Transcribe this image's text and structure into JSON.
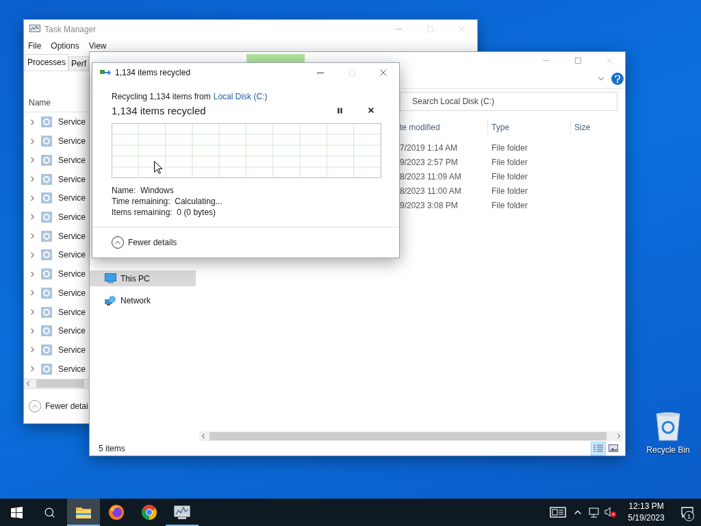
{
  "task_manager": {
    "title": "Task Manager",
    "menu": [
      "File",
      "Options",
      "View"
    ],
    "tabs": [
      {
        "label": "Processes",
        "selected": true
      },
      {
        "label": "Perf",
        "selected": false
      }
    ],
    "column": "Name",
    "rows": [
      {
        "name": "Service",
        "expanded": false
      },
      {
        "name": "Service",
        "expanded": false
      },
      {
        "name": "Service",
        "expanded": false
      },
      {
        "name": "Service",
        "expanded": false
      },
      {
        "name": "Service",
        "expanded": false
      },
      {
        "name": "Service",
        "expanded": false
      },
      {
        "name": "Service",
        "expanded": false
      },
      {
        "name": "Service",
        "expanded": false
      },
      {
        "name": "Service",
        "expanded": false
      },
      {
        "name": "Service",
        "expanded": false
      },
      {
        "name": "Service",
        "expanded": false
      },
      {
        "name": "Service",
        "expanded": false
      },
      {
        "name": "Service",
        "expanded": false
      },
      {
        "name": "Service",
        "expanded": false
      }
    ],
    "footer": "Fewer detai"
  },
  "explorer": {
    "search": {
      "placeholder": "Search Local Disk (C:)"
    },
    "columns": [
      "te modified",
      "Type",
      "Size"
    ],
    "rows": [
      {
        "date": "7/2019 1:14 AM",
        "type": "File folder"
      },
      {
        "date": "9/2023 2:57 PM",
        "type": "File folder"
      },
      {
        "date": "8/2023 11:09 AM",
        "type": "File folder"
      },
      {
        "date": "8/2023 11:00 AM",
        "type": "File folder"
      },
      {
        "date": "9/2023 3:08 PM",
        "type": "File folder"
      }
    ],
    "nav": [
      {
        "label": "This PC",
        "kind": "pc",
        "selected": true
      },
      {
        "label": "Network",
        "kind": "network",
        "selected": false
      }
    ],
    "status": "5 items"
  },
  "dialog": {
    "title": "1,134 items recycled",
    "source_prefix": "Recycling 1,134 items from",
    "source_link": "Local Disk (C:)",
    "heading": "1,134 items recycled",
    "details": [
      {
        "label": "Name:",
        "value": "Windows"
      },
      {
        "label": "Time remaining:",
        "value": "Calculating..."
      },
      {
        "label": "Items remaining:",
        "value": "0 (0 bytes)"
      }
    ],
    "toggle": "Fewer details"
  },
  "desktop_icons": [
    {
      "label": "Recycle Bin"
    }
  ],
  "taskbar": {
    "apps": [
      {
        "kind": "explorer",
        "selected": true,
        "running": true
      },
      {
        "kind": "firefox",
        "selected": false,
        "running": false
      },
      {
        "kind": "chrome",
        "selected": false,
        "running": false
      },
      {
        "kind": "taskmgr",
        "selected": false,
        "running": true
      }
    ],
    "time": "12:13 PM",
    "date": "5/19/2023",
    "notifications": "1"
  }
}
